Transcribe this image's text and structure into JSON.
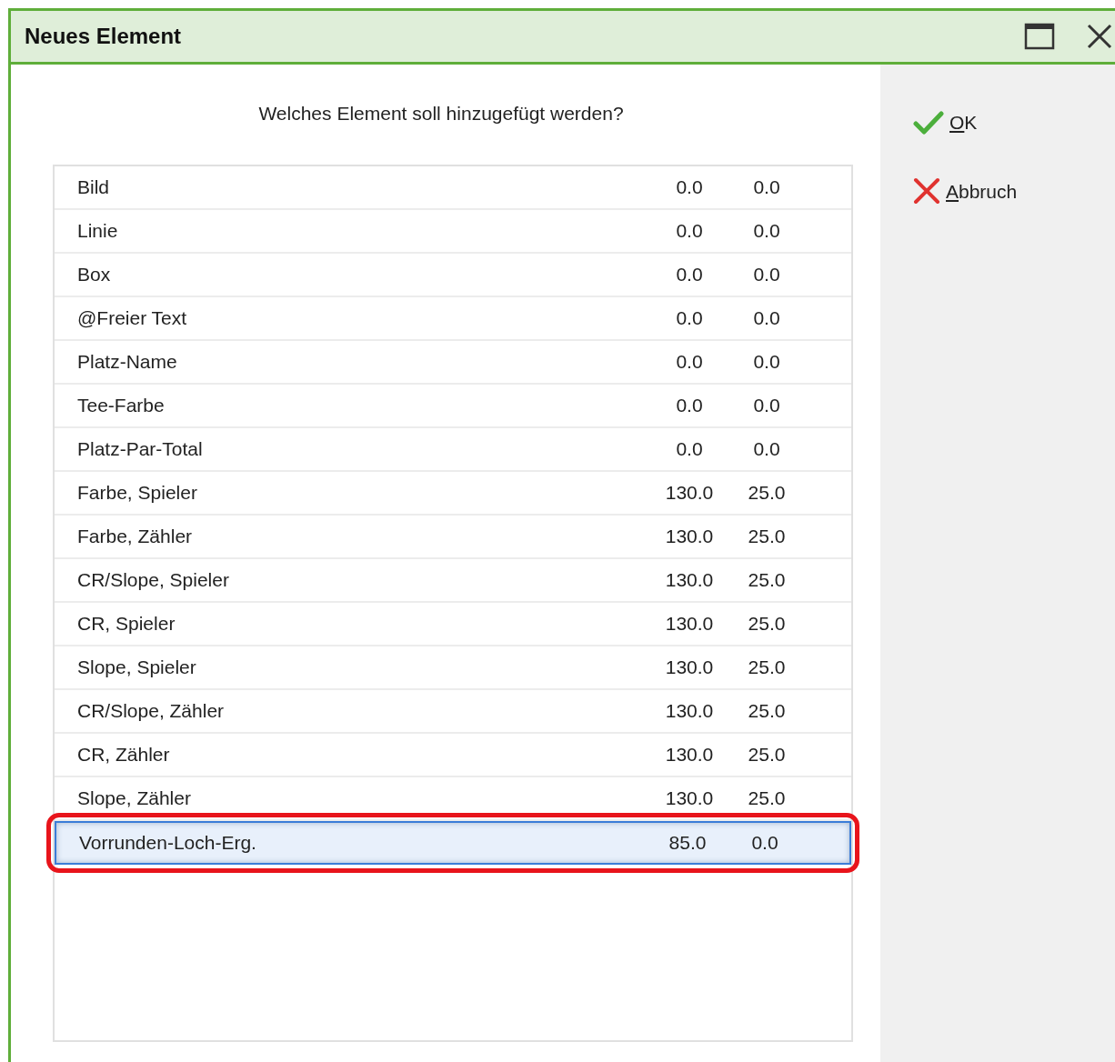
{
  "window": {
    "title": "Neues Element"
  },
  "prompt": "Welches Element soll hinzugefügt werden?",
  "elements": [
    {
      "name": "Bild",
      "col_2": "0.0",
      "col_3": "0.0",
      "selected": false
    },
    {
      "name": "Linie",
      "col_2": "0.0",
      "col_3": "0.0",
      "selected": false
    },
    {
      "name": "Box",
      "col_2": "0.0",
      "col_3": "0.0",
      "selected": false
    },
    {
      "name": "@Freier Text",
      "col_2": "0.0",
      "col_3": "0.0",
      "selected": false
    },
    {
      "name": "Platz-Name",
      "col_2": "0.0",
      "col_3": "0.0",
      "selected": false
    },
    {
      "name": "Tee-Farbe",
      "col_2": "0.0",
      "col_3": "0.0",
      "selected": false
    },
    {
      "name": "Platz-Par-Total",
      "col_2": "0.0",
      "col_3": "0.0",
      "selected": false
    },
    {
      "name": "Farbe, Spieler",
      "col_2": "130.0",
      "col_3": "25.0",
      "selected": false
    },
    {
      "name": "Farbe, Zähler",
      "col_2": "130.0",
      "col_3": "25.0",
      "selected": false
    },
    {
      "name": "CR/Slope, Spieler",
      "col_2": "130.0",
      "col_3": "25.0",
      "selected": false
    },
    {
      "name": "CR, Spieler",
      "col_2": "130.0",
      "col_3": "25.0",
      "selected": false
    },
    {
      "name": "Slope, Spieler",
      "col_2": "130.0",
      "col_3": "25.0",
      "selected": false
    },
    {
      "name": "CR/Slope, Zähler",
      "col_2": "130.0",
      "col_3": "25.0",
      "selected": false
    },
    {
      "name": "CR, Zähler",
      "col_2": "130.0",
      "col_3": "25.0",
      "selected": false
    },
    {
      "name": "Slope, Zähler",
      "col_2": "130.0",
      "col_3": "25.0",
      "selected": false
    },
    {
      "name": "Vorrunden-Loch-Erg.",
      "col_2": "85.0",
      "col_3": "0.0",
      "selected": true
    }
  ],
  "buttons": [
    {
      "kind": "ok",
      "label": "OK"
    },
    {
      "kind": "cancel",
      "label": "Abbruch"
    }
  ]
}
